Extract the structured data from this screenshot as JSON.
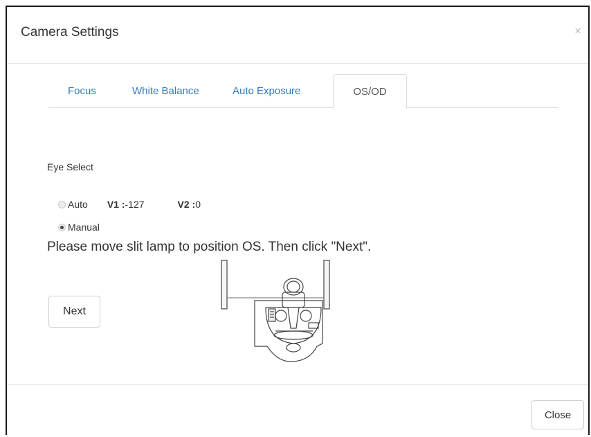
{
  "modal": {
    "title": "Camera Settings",
    "close_icon": "×"
  },
  "tabs": [
    {
      "label": "Focus",
      "active": false
    },
    {
      "label": "White Balance",
      "active": false
    },
    {
      "label": "Auto Exposure",
      "active": false
    },
    {
      "label": "OS/OD",
      "active": true
    }
  ],
  "eye_select": {
    "label": "Eye Select",
    "options": [
      {
        "label": "Auto",
        "checked": false
      },
      {
        "label": "Manual",
        "checked": true
      }
    ],
    "v1": {
      "label": "V1 :",
      "value": "-127"
    },
    "v2": {
      "label": "V2 :",
      "value": "0"
    }
  },
  "instruction": "Please move slit lamp to position OS. Then click \"Next\".",
  "buttons": {
    "next": "Next",
    "close": "Close"
  },
  "icons": {
    "device": "slit-lamp-illustration"
  }
}
